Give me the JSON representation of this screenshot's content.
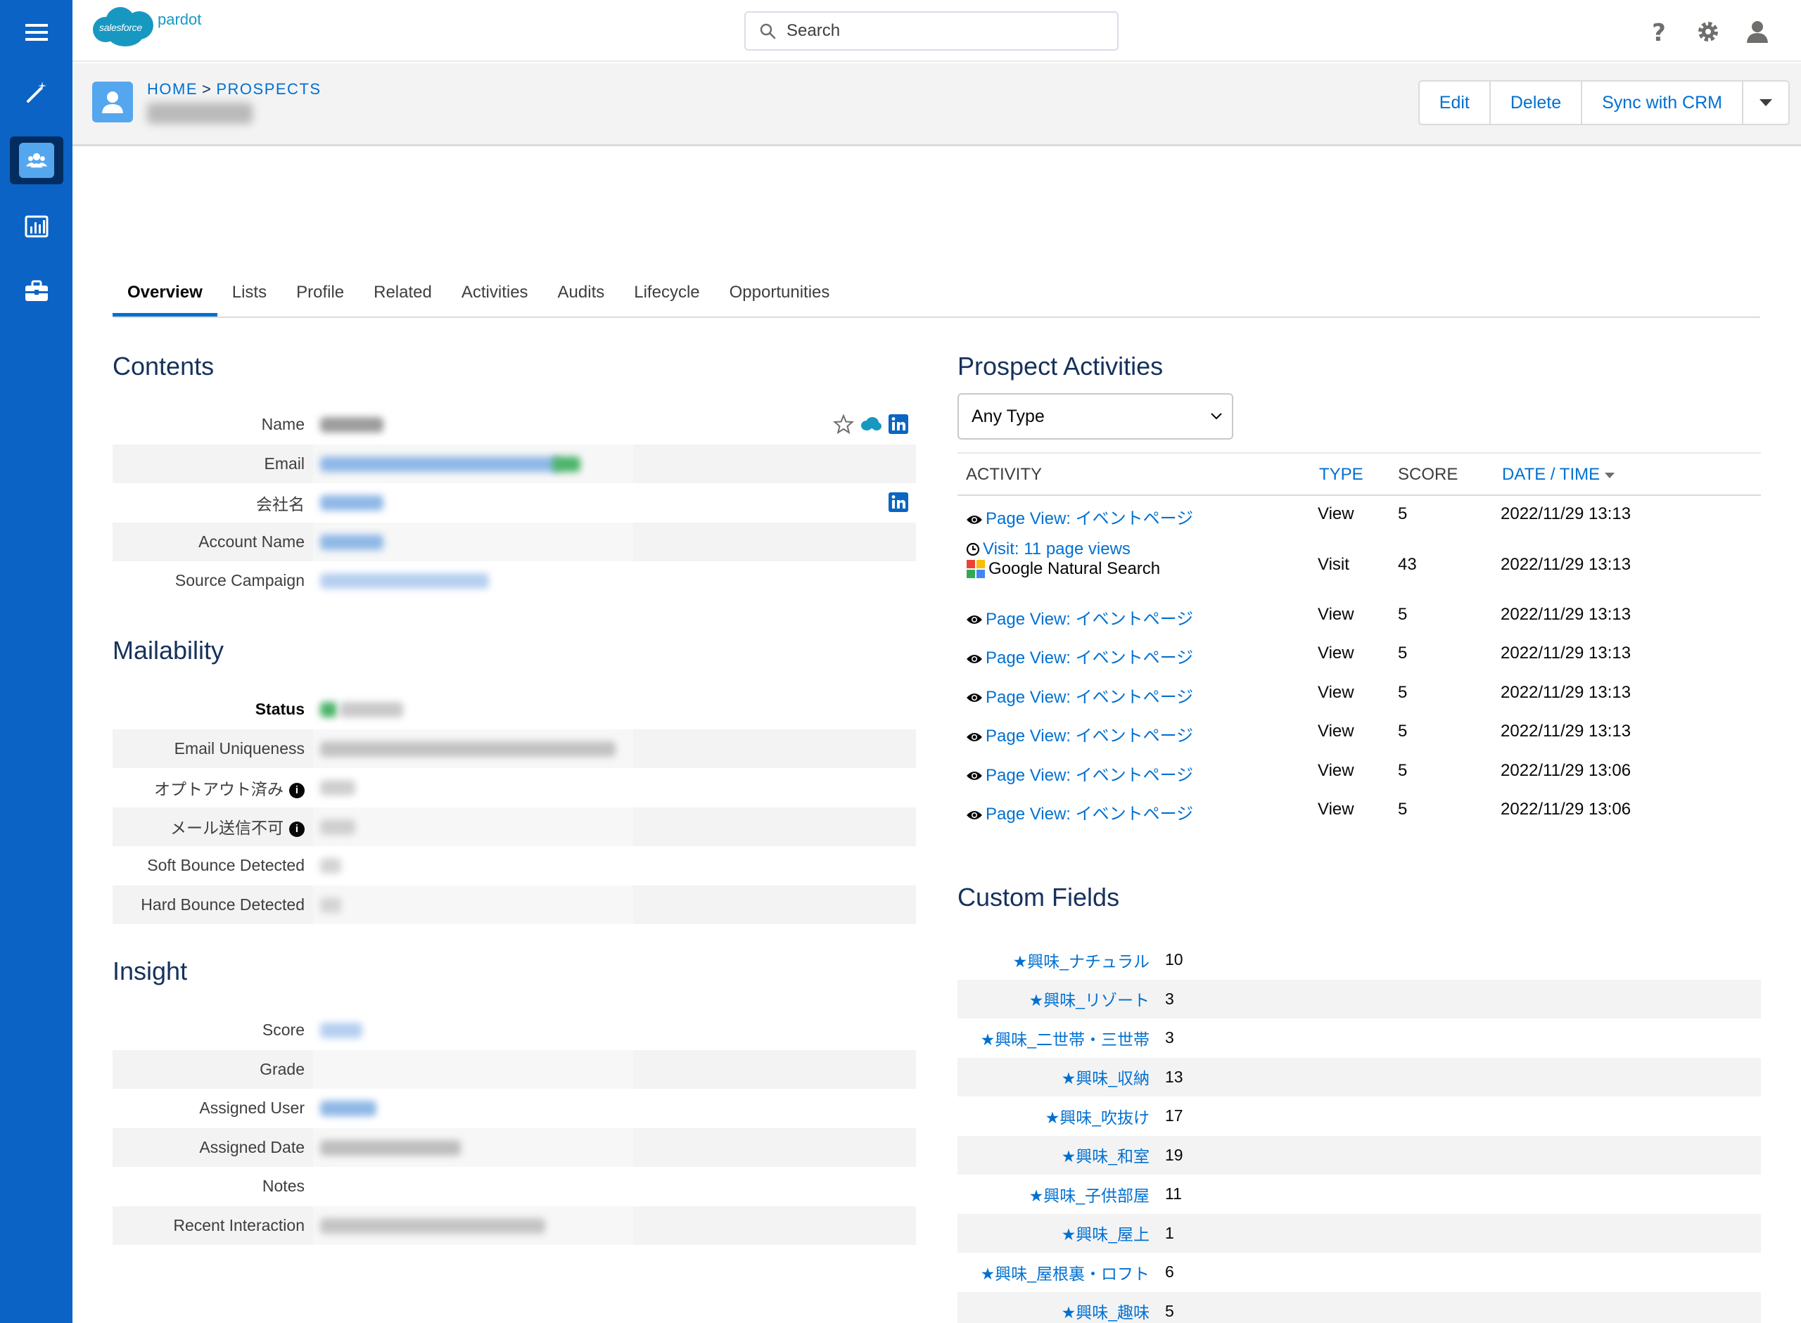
{
  "app": {
    "brand_cloud_text": "salesforce",
    "brand_name": "pardot"
  },
  "nav_rail": {
    "items": [
      {
        "name": "menu-icon"
      },
      {
        "name": "magic-wand-icon"
      },
      {
        "name": "prospects-icon",
        "active": true
      },
      {
        "name": "reports-icon"
      },
      {
        "name": "admin-briefcase-icon"
      }
    ]
  },
  "header": {
    "search": {
      "placeholder": "Search"
    },
    "icons": [
      "help-icon",
      "settings-icon",
      "user-icon"
    ]
  },
  "record": {
    "breadcrumb": {
      "home": "HOME",
      "separator": ">",
      "section": "PROSPECTS"
    },
    "actions": {
      "edit": "Edit",
      "delete": "Delete",
      "sync": "Sync with CRM"
    }
  },
  "tabs": [
    {
      "label": "Overview",
      "active": true
    },
    {
      "label": "Lists"
    },
    {
      "label": "Profile"
    },
    {
      "label": "Related"
    },
    {
      "label": "Activities"
    },
    {
      "label": "Audits"
    },
    {
      "label": "Lifecycle"
    },
    {
      "label": "Opportunities"
    }
  ],
  "contents": {
    "title": "Contents",
    "fields": [
      {
        "label": "Name"
      },
      {
        "label": "Email"
      },
      {
        "label": "会社名"
      },
      {
        "label": "Account Name"
      },
      {
        "label": "Source Campaign"
      }
    ]
  },
  "mailability": {
    "title": "Mailability",
    "fields": [
      {
        "label": "Status"
      },
      {
        "label": "Email Uniqueness"
      },
      {
        "label": "オプトアウト済み"
      },
      {
        "label": "メール送信不可"
      },
      {
        "label": "Soft Bounce Detected"
      },
      {
        "label": "Hard Bounce Detected"
      }
    ],
    "info_glyph": "i"
  },
  "insight": {
    "title": "Insight",
    "fields": [
      {
        "label": "Score"
      },
      {
        "label": "Grade"
      },
      {
        "label": "Assigned User"
      },
      {
        "label": "Assigned Date"
      },
      {
        "label": "Notes"
      },
      {
        "label": "Recent Interaction"
      }
    ]
  },
  "activities": {
    "title": "Prospect Activities",
    "filter": {
      "selected": "Any Type"
    },
    "columns": {
      "activity": "ACTIVITY",
      "type": "TYPE",
      "score": "SCORE",
      "date_time": "DATE / TIME"
    },
    "rows": [
      {
        "activity": "Page View: イベントページ",
        "type": "View",
        "score": "5",
        "datetime": "2022/11/29 13:13"
      },
      {
        "activity": "Visit: 11 page views",
        "sub": "Google Natural Search",
        "type": "Visit",
        "score": "43",
        "datetime": "2022/11/29 13:13"
      },
      {
        "activity": "Page View: イベントページ",
        "type": "View",
        "score": "5",
        "datetime": "2022/11/29 13:13"
      },
      {
        "activity": "Page View: イベントページ",
        "type": "View",
        "score": "5",
        "datetime": "2022/11/29 13:13"
      },
      {
        "activity": "Page View: イベントページ",
        "type": "View",
        "score": "5",
        "datetime": "2022/11/29 13:13"
      },
      {
        "activity": "Page View: イベントページ",
        "type": "View",
        "score": "5",
        "datetime": "2022/11/29 13:13"
      },
      {
        "activity": "Page View: イベントページ",
        "type": "View",
        "score": "5",
        "datetime": "2022/11/29 13:06"
      },
      {
        "activity": "Page View: イベントページ",
        "type": "View",
        "score": "5",
        "datetime": "2022/11/29 13:06"
      }
    ]
  },
  "custom_fields": {
    "title": "Custom Fields",
    "rows": [
      {
        "label": "★興味_ナチュラル",
        "value": "10"
      },
      {
        "label": "★興味_リゾート",
        "value": "3"
      },
      {
        "label": "★興味_二世帯・三世帯",
        "value": "3"
      },
      {
        "label": "★興味_収納",
        "value": "13"
      },
      {
        "label": "★興味_吹抜け",
        "value": "17"
      },
      {
        "label": "★興味_和室",
        "value": "19"
      },
      {
        "label": "★興味_子供部屋",
        "value": "11"
      },
      {
        "label": "★興味_屋上",
        "value": "1"
      },
      {
        "label": "★興味_屋根裏・ロフト",
        "value": "6"
      },
      {
        "label": "★興味_趣味",
        "value": "5"
      }
    ]
  },
  "colors": {
    "rail": "#0b63c5",
    "rail_active": "#032d60",
    "link": "#0070d2",
    "brand_cloud": "#1798c1",
    "avatar": "#54a6ee",
    "linkedin": "#0a66c2"
  }
}
